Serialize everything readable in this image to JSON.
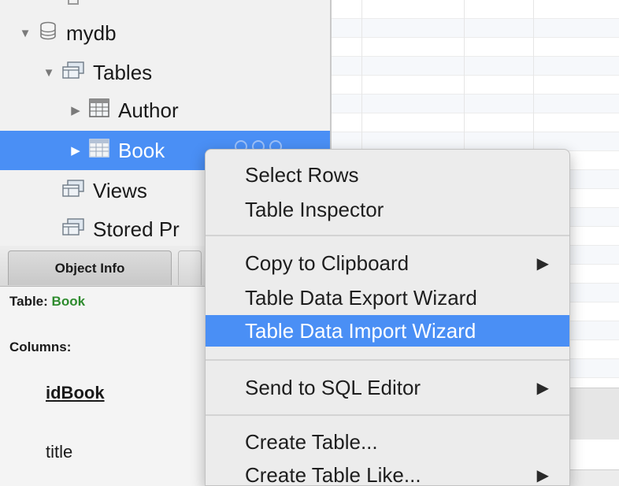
{
  "tree": {
    "db": {
      "label": "mydb",
      "expanded": true
    },
    "tables_group": {
      "label": "Tables",
      "expanded": true
    },
    "tables": [
      {
        "label": "Author",
        "selected": false
      },
      {
        "label": "Book",
        "selected": true
      }
    ],
    "views_label": "Views",
    "stored_label": "Stored Pr"
  },
  "info_panel": {
    "tab_label": "Object Info",
    "table_prefix": "Table:",
    "table_name": "Book",
    "columns_label": "Columns:",
    "columns": [
      {
        "name": "idBook",
        "primary_key": true
      },
      {
        "name": "title",
        "primary_key": false
      }
    ]
  },
  "context_menu": {
    "items": [
      {
        "label": "Select Rows",
        "submenu": false,
        "highlighted": false
      },
      {
        "label": "Table Inspector",
        "submenu": false,
        "highlighted": false
      },
      {
        "label": "Copy to Clipboard",
        "submenu": true,
        "highlighted": false
      },
      {
        "label": "Table Data Export Wizard",
        "submenu": false,
        "highlighted": false
      },
      {
        "label": "Table Data Import Wizard",
        "submenu": false,
        "highlighted": true
      },
      {
        "label": "Send to SQL Editor",
        "submenu": true,
        "highlighted": false
      },
      {
        "label": "Create Table...",
        "submenu": false,
        "highlighted": false
      },
      {
        "label": "Create Table Like...",
        "submenu": true,
        "highlighted": false
      }
    ],
    "submenu_arrow": "▶"
  },
  "colors": {
    "selection": "#4a8ff5",
    "table_name_green": "#2e8b2e"
  }
}
